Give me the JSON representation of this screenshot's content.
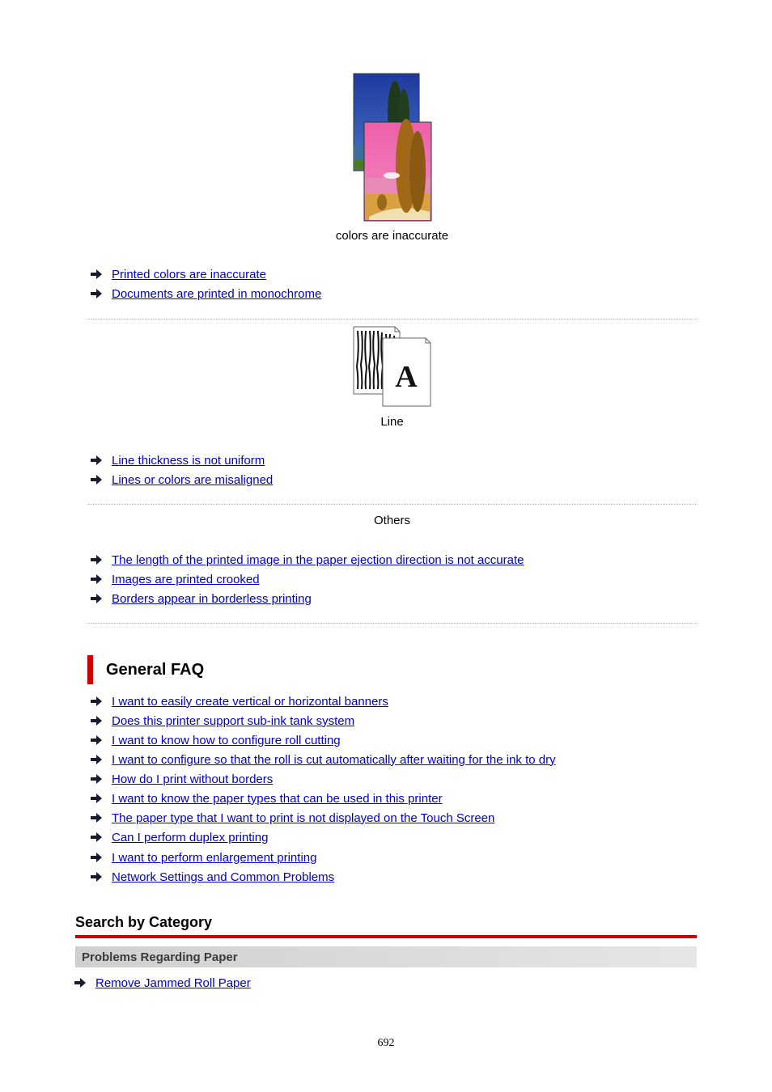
{
  "sections": {
    "colors": {
      "caption": "colors are inaccurate",
      "image_icon": "color-comparison-photo-icon",
      "links": [
        "Printed colors are inaccurate",
        "Documents are printed in monochrome"
      ]
    },
    "line": {
      "caption": "Line",
      "image_icon": "line-misaligned-document-icon",
      "links": [
        "Line thickness is not uniform",
        "Lines or colors are misaligned"
      ]
    },
    "others": {
      "caption": "Others",
      "links": [
        "The length of the printed image in the paper ejection direction is not accurate",
        "Images are printed crooked",
        "Borders appear in borderless printing"
      ]
    }
  },
  "general_faq": {
    "title": "General FAQ",
    "links": [
      "I want to easily create vertical or horizontal banners",
      "Does this printer support sub-ink tank system",
      "I want to know how to configure roll cutting",
      "I want to configure so that the roll is cut automatically after waiting for the ink to dry",
      "How do I print without borders",
      "I want to know the paper types that can be used in this printer",
      "The paper type that I want to print is not displayed on the Touch Screen",
      "Can I perform duplex printing",
      "I want to perform enlargement printing",
      "Network Settings and Common Problems"
    ]
  },
  "search_by_category": {
    "title": "Search by Category",
    "category": "Problems Regarding Paper",
    "links": [
      "Remove Jammed Roll Paper"
    ]
  },
  "footer": {
    "page_number": "692"
  },
  "colors": {
    "link": "#0000cc",
    "accent_red": "#cc0000",
    "arrow": "#1a1a2e"
  }
}
